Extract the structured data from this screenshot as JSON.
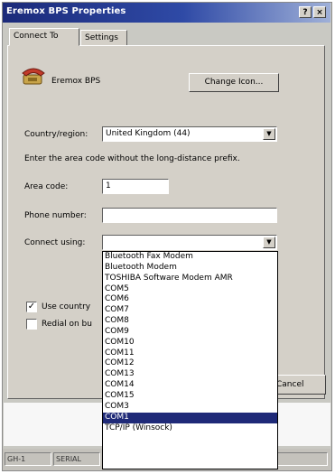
{
  "window": {
    "title": "Eremox BPS Properties",
    "help_label": "?",
    "close_label": "×"
  },
  "tabs": [
    {
      "label": "Connect To"
    },
    {
      "label": "Settings"
    }
  ],
  "connection": {
    "name": "Eremox BPS",
    "change_icon_label": "Change Icon..."
  },
  "country": {
    "label": "Country/region:",
    "value": "United Kingdom (44)"
  },
  "area_hint": "Enter the area code without the long-distance prefix.",
  "area_code": {
    "label": "Area code:",
    "value": "1"
  },
  "phone_number": {
    "label": "Phone number:",
    "value": ""
  },
  "connect_using": {
    "label": "Connect using:",
    "value": "",
    "options": [
      "Bluetooth Fax Modem",
      "Bluetooth Modem",
      "TOSHIBA Software Modem AMR",
      "COM5",
      "COM6",
      "COM7",
      "COM8",
      "COM9",
      "COM10",
      "COM11",
      "COM12",
      "COM13",
      "COM14",
      "COM15",
      "COM3",
      "COM1",
      "TCP/IP (Winsock)"
    ],
    "selected_index": 15
  },
  "use_country_checkbox": {
    "label": "Use country",
    "checked": true
  },
  "redial_checkbox": {
    "label": "Redial on bu",
    "checked": false
  },
  "buttons": {
    "cancel_label": "Cancel"
  },
  "status_bar": {
    "left_text": "GH-1",
    "mid_text": "SERIAL"
  },
  "icons": {
    "connection_icon": "phone-modem-icon",
    "dropdown_arrow": "chevron-down-icon",
    "checkmark": "check-icon"
  }
}
